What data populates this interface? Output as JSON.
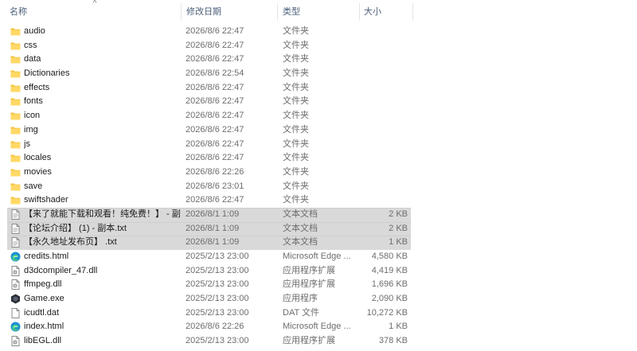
{
  "header": {
    "name_label": "名称",
    "date_label": "修改日期",
    "type_label": "类型",
    "size_label": "大小",
    "sort_indicator": "^"
  },
  "files": [
    {
      "name": "audio",
      "date": "2026/8/6 22:47",
      "type": "文件夹",
      "size": "",
      "icon": "folder-icon",
      "selected": false
    },
    {
      "name": "css",
      "date": "2026/8/6 22:47",
      "type": "文件夹",
      "size": "",
      "icon": "folder-icon",
      "selected": false
    },
    {
      "name": "data",
      "date": "2026/8/6 22:47",
      "type": "文件夹",
      "size": "",
      "icon": "folder-icon",
      "selected": false
    },
    {
      "name": "Dictionaries",
      "date": "2026/8/6 22:54",
      "type": "文件夹",
      "size": "",
      "icon": "folder-icon",
      "selected": false
    },
    {
      "name": "effects",
      "date": "2026/8/6 22:47",
      "type": "文件夹",
      "size": "",
      "icon": "folder-icon",
      "selected": false
    },
    {
      "name": "fonts",
      "date": "2026/8/6 22:47",
      "type": "文件夹",
      "size": "",
      "icon": "folder-icon",
      "selected": false
    },
    {
      "name": "icon",
      "date": "2026/8/6 22:47",
      "type": "文件夹",
      "size": "",
      "icon": "folder-icon",
      "selected": false
    },
    {
      "name": "img",
      "date": "2026/8/6 22:47",
      "type": "文件夹",
      "size": "",
      "icon": "folder-icon",
      "selected": false
    },
    {
      "name": "js",
      "date": "2026/8/6 22:47",
      "type": "文件夹",
      "size": "",
      "icon": "folder-icon",
      "selected": false
    },
    {
      "name": "locales",
      "date": "2026/8/6 22:47",
      "type": "文件夹",
      "size": "",
      "icon": "folder-icon",
      "selected": false
    },
    {
      "name": "movies",
      "date": "2026/8/6 22:26",
      "type": "文件夹",
      "size": "",
      "icon": "folder-icon",
      "selected": false
    },
    {
      "name": "save",
      "date": "2026/8/6 23:01",
      "type": "文件夹",
      "size": "",
      "icon": "folder-icon",
      "selected": false
    },
    {
      "name": "swiftshader",
      "date": "2026/8/6 22:47",
      "type": "文件夹",
      "size": "",
      "icon": "folder-icon",
      "selected": false
    },
    {
      "name": "【来了就能下载和观看！纯免费！】 - 副...",
      "date": "2026/8/1 1:09",
      "type": "文本文档",
      "size": "2 KB",
      "icon": "text-file-icon",
      "selected": true
    },
    {
      "name": "【论坛介绍】 (1) - 副本.txt",
      "date": "2026/8/1 1:09",
      "type": "文本文档",
      "size": "2 KB",
      "icon": "text-file-icon",
      "selected": true
    },
    {
      "name": "【永久地址发布页】 .txt",
      "date": "2026/8/1 1:09",
      "type": "文本文档",
      "size": "1 KB",
      "icon": "text-file-icon",
      "selected": true
    },
    {
      "name": "credits.html",
      "date": "2025/2/13 23:00",
      "type": "Microsoft Edge ...",
      "size": "4,580 KB",
      "icon": "edge-icon",
      "selected": false
    },
    {
      "name": "d3dcompiler_47.dll",
      "date": "2025/2/13 23:00",
      "type": "应用程序扩展",
      "size": "4,419 KB",
      "icon": "dll-file-icon",
      "selected": false
    },
    {
      "name": "ffmpeg.dll",
      "date": "2025/2/13 23:00",
      "type": "应用程序扩展",
      "size": "1,696 KB",
      "icon": "dll-file-icon",
      "selected": false
    },
    {
      "name": "Game.exe",
      "date": "2025/2/13 23:00",
      "type": "应用程序",
      "size": "2,090 KB",
      "icon": "exe-icon",
      "selected": false
    },
    {
      "name": "icudtl.dat",
      "date": "2025/2/13 23:00",
      "type": "DAT 文件",
      "size": "10,272 KB",
      "icon": "blank-file-icon",
      "selected": false
    },
    {
      "name": "index.html",
      "date": "2026/8/6 22:26",
      "type": "Microsoft Edge ...",
      "size": "1 KB",
      "icon": "edge-icon",
      "selected": false
    },
    {
      "name": "libEGL.dll",
      "date": "2025/2/13 23:00",
      "type": "应用程序扩展",
      "size": "378 KB",
      "icon": "dll-file-icon",
      "selected": false
    }
  ]
}
